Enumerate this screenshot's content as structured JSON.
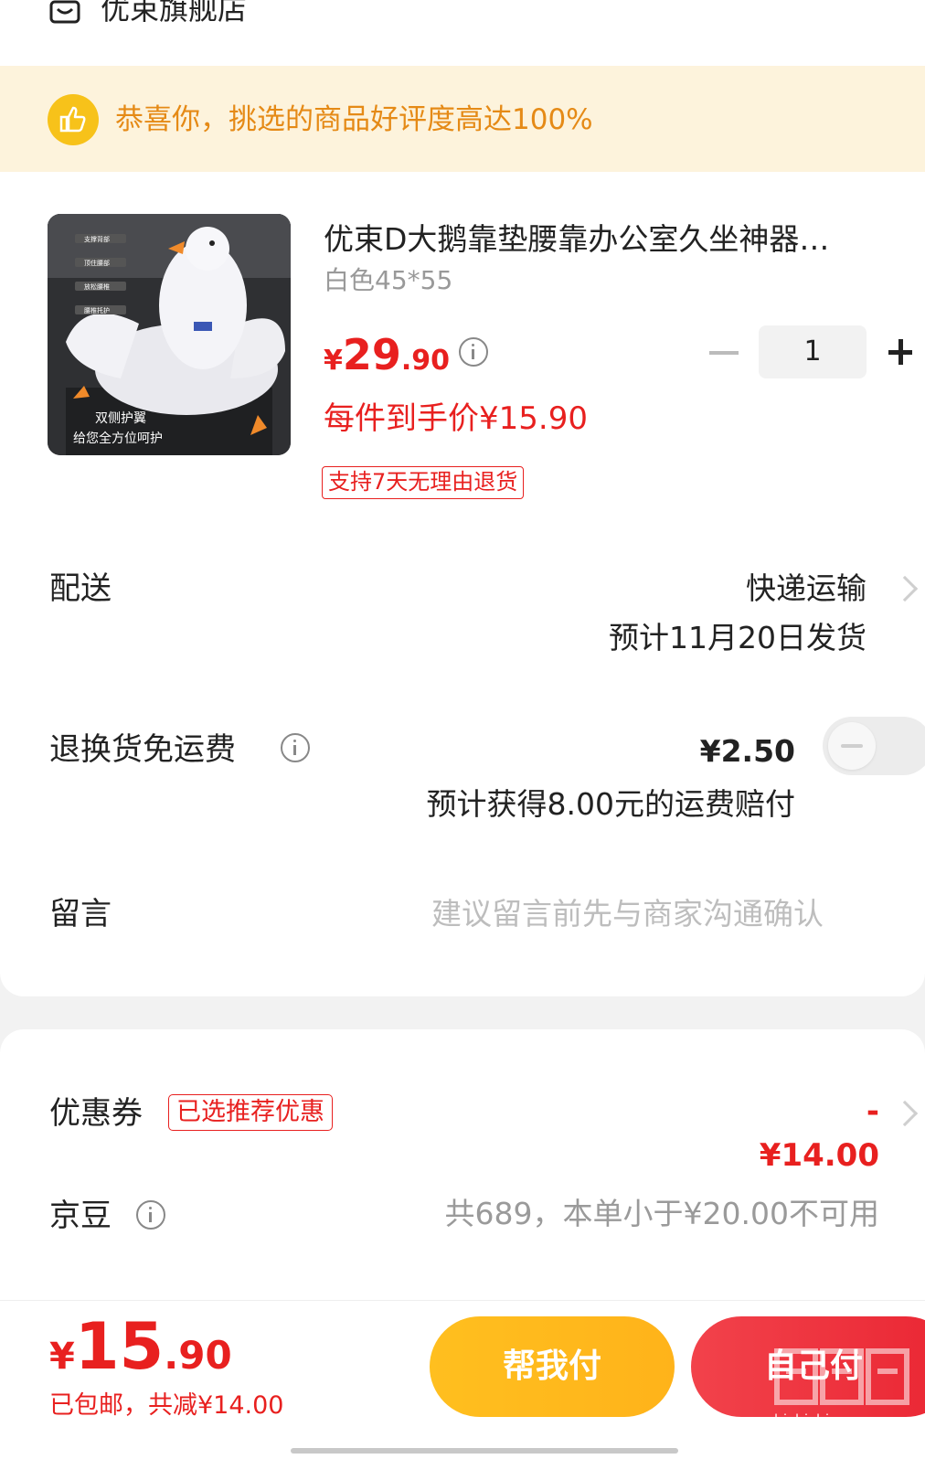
{
  "store": {
    "name": "优束旗舰店",
    "icon": "store-icon"
  },
  "banner": {
    "icon": "thumbs-up-icon",
    "text": "恭喜你，挑选的商品好评度高达100%"
  },
  "product": {
    "title": "优束D大鹅靠垫腰靠办公室久坐神器…",
    "spec": "白色45*55",
    "price_yen": "¥",
    "price_int": "29",
    "price_dec": ".90",
    "quantity": "1",
    "unit_price": "每件到手价¥15.90",
    "return_badge": "支持7天无理由退货",
    "image_caption_line1": "双侧护翼",
    "image_caption_line2": "给您全方位呵护",
    "image_labels": [
      "支撑背部",
      "顶住腰部",
      "放松腰椎",
      "腰椎托护"
    ]
  },
  "delivery": {
    "label": "配送",
    "method": "快递运输",
    "eta": "预计11月20日发货"
  },
  "return_shipping": {
    "label": "退换货免运费",
    "price": "¥2.50",
    "note": "预计获得8.00元的运费赔付",
    "enabled": false
  },
  "note": {
    "label": "留言",
    "placeholder": "建议留言前先与商家沟通确认"
  },
  "coupon": {
    "label": "优惠券",
    "badge": "已选推荐优惠",
    "amount": "-¥14.00"
  },
  "beans": {
    "label": "京豆",
    "text": "共689，本单小于¥20.00不可用"
  },
  "footer": {
    "total_yen": "¥",
    "total_int": "15",
    "total_dec": ".90",
    "sub": "已包邮，共减¥14.00",
    "help_pay": "帮我付",
    "self_pay": "自己付"
  },
  "watermark": {
    "brand": "值值值",
    "site": "zhizhizhi.com"
  },
  "colors": {
    "accent_red": "#e8201f",
    "banner_bg": "#fdf3dc",
    "banner_text": "#e58a16",
    "help_btn": "#ffb31a",
    "self_btn": "#ea2633"
  }
}
